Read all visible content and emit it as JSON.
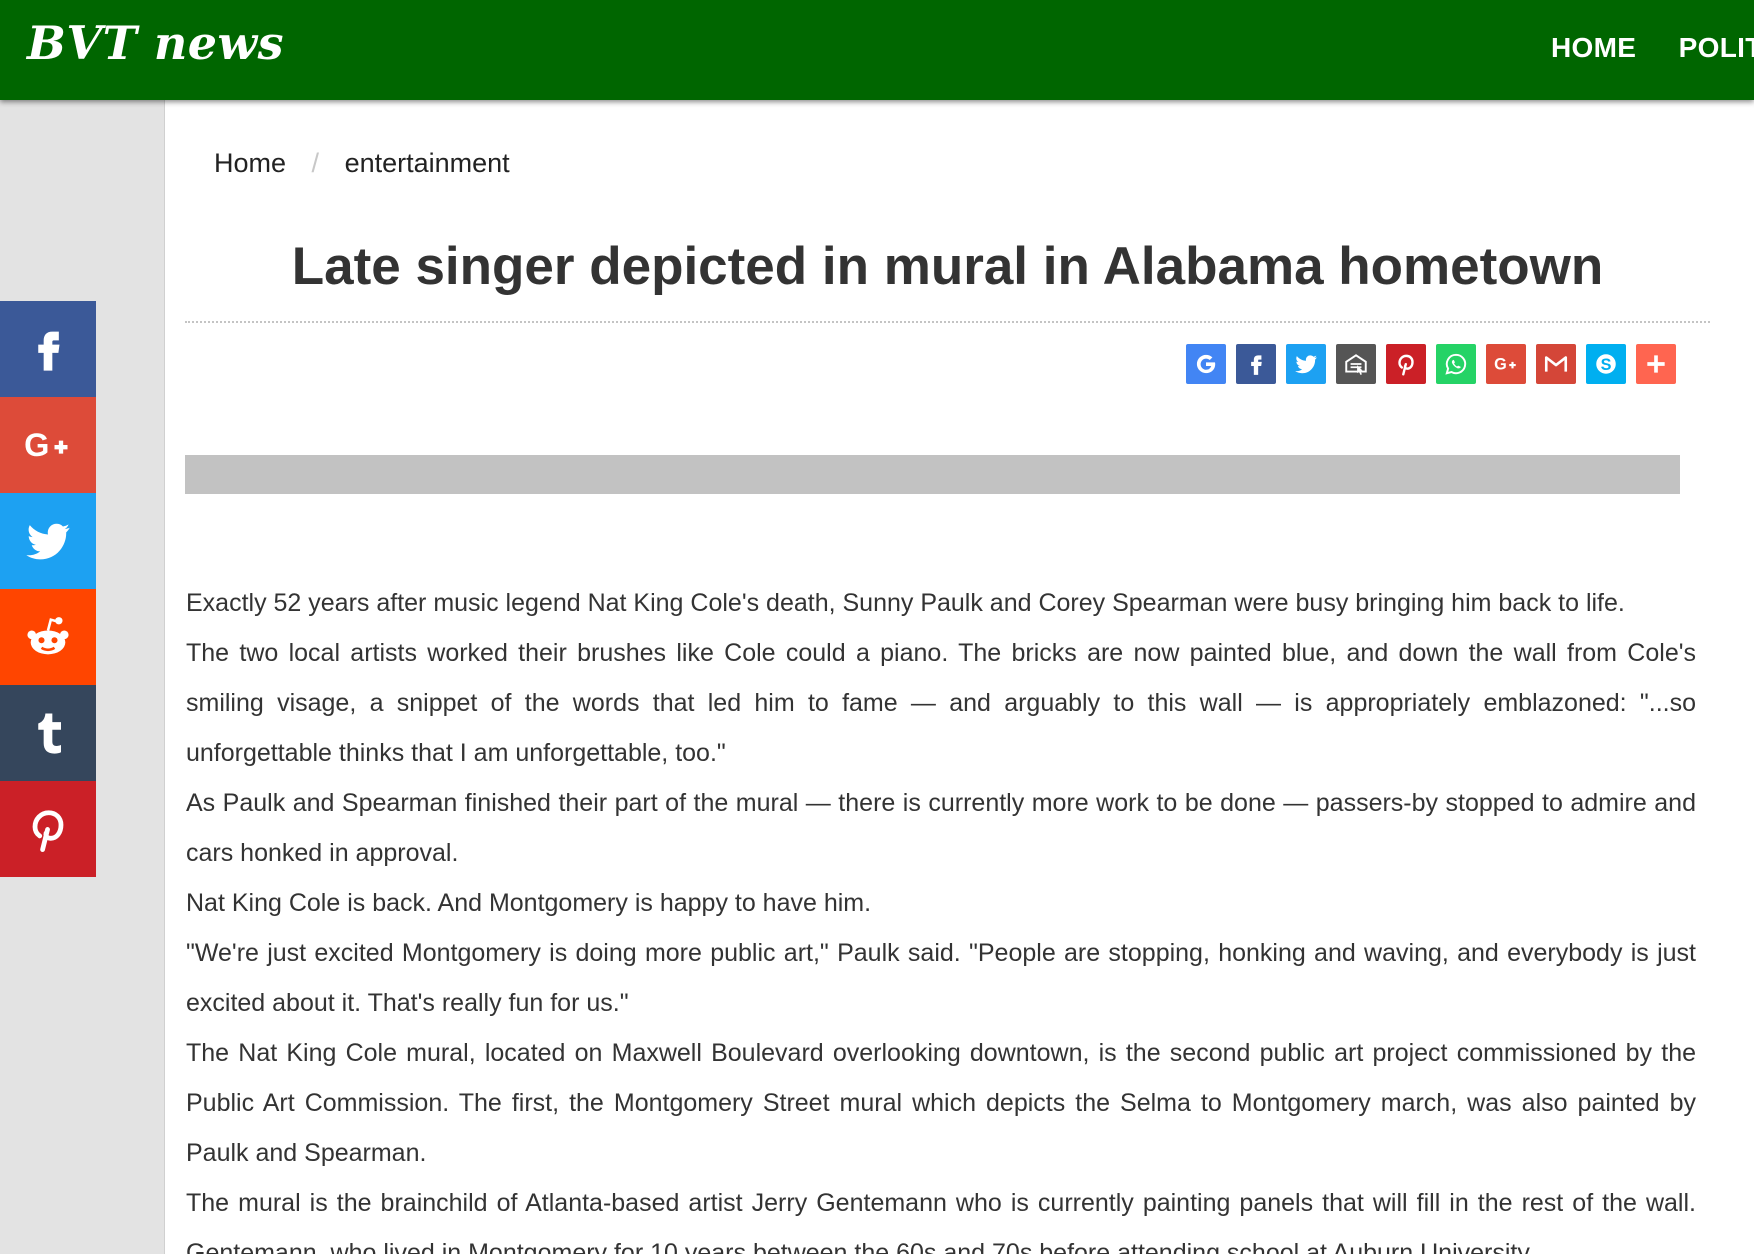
{
  "site": {
    "logo": "BVT news",
    "nav": [
      "HOME",
      "POLIT"
    ]
  },
  "breadcrumb": {
    "home": "Home",
    "separator": "/",
    "category": "entertainment"
  },
  "article": {
    "title": "Late singer depicted in mural in Alabama hometown",
    "paragraphs": [
      "Exactly 52 years after music legend Nat King Cole's death, Sunny Paulk and Corey Spearman were busy bringing him back to life.",
      "The two local artists worked their brushes like Cole could a piano. The bricks are now painted blue, and down the wall from Cole's smiling visage, a snippet of the words that led him to fame — and arguably to this wall — is appropriately emblazoned: \"...so unforgettable thinks that I am unforgettable, too.\"",
      "As Paulk and Spearman finished their part of the mural — there is currently more work to be done — passers-by stopped to admire and cars honked in approval.",
      "Nat King Cole is back. And Montgomery is happy to have him.",
      "\"We're just excited Montgomery is doing more public art,\" Paulk said. \"People are stopping, honking and waving, and everybody is just excited about it. That's really fun for us.\"",
      "The Nat King Cole mural, located on Maxwell Boulevard overlooking downtown, is the second public art project commissioned by the Public Art Commission. The first, the Montgomery Street mural which depicts the Selma to Montgomery march, was also painted by Paulk and Spearman.",
      "The mural is the brainchild of Atlanta-based artist Jerry Gentemann who is currently painting panels that will fill in the rest of the wall. Gentemann, who lived in Montgomery for 10 years between the 60s and 70s before attending school at Auburn University,"
    ]
  },
  "share_buttons": [
    {
      "icon": "google-icon",
      "color": "#4285f4"
    },
    {
      "icon": "facebook-icon",
      "color": "#3b5998"
    },
    {
      "icon": "twitter-icon",
      "color": "#1da1f2"
    },
    {
      "icon": "print-icon",
      "color": "#555555"
    },
    {
      "icon": "pinterest-icon",
      "color": "#cb2027"
    },
    {
      "icon": "whatsapp-icon",
      "color": "#25d366"
    },
    {
      "icon": "google-plus-icon",
      "color": "#dd4b39"
    },
    {
      "icon": "gmail-icon",
      "color": "#d44638"
    },
    {
      "icon": "skype-icon",
      "color": "#00aff0"
    },
    {
      "icon": "more-icon",
      "color": "#ff6550"
    }
  ],
  "side_share": [
    {
      "icon": "facebook-icon",
      "color": "#3b5998"
    },
    {
      "icon": "google-plus-icon",
      "color": "#dd4b39"
    },
    {
      "icon": "twitter-icon",
      "color": "#1da1f2"
    },
    {
      "icon": "reddit-icon",
      "color": "#ff4500"
    },
    {
      "icon": "tumblr-icon",
      "color": "#35465c"
    },
    {
      "icon": "pinterest-icon",
      "color": "#cb2027"
    }
  ],
  "colors": {
    "header": "#006600",
    "ad_bar": "#c2c2c2"
  }
}
